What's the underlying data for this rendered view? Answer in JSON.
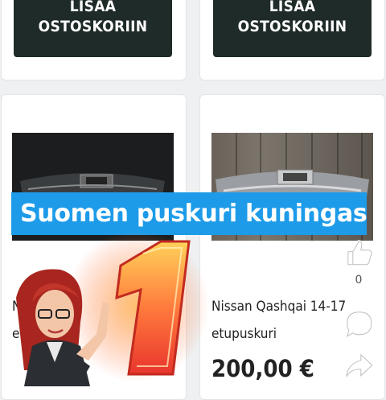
{
  "buttons": {
    "add_to_cart_line1": "LISÄÄ",
    "add_to_cart_line2": "OSTOSKORIIN"
  },
  "banner": {
    "text": "Suomen puskuri kuningas"
  },
  "products": [
    {
      "title": "Nis",
      "title_line2": "etu"
    },
    {
      "title": "Nissan Qashqai 14-17",
      "title_line2": "etupuskuri",
      "price": "200,00 €"
    }
  ],
  "side_actions": {
    "like_count": "0"
  },
  "overlay": {
    "badge": "1"
  }
}
